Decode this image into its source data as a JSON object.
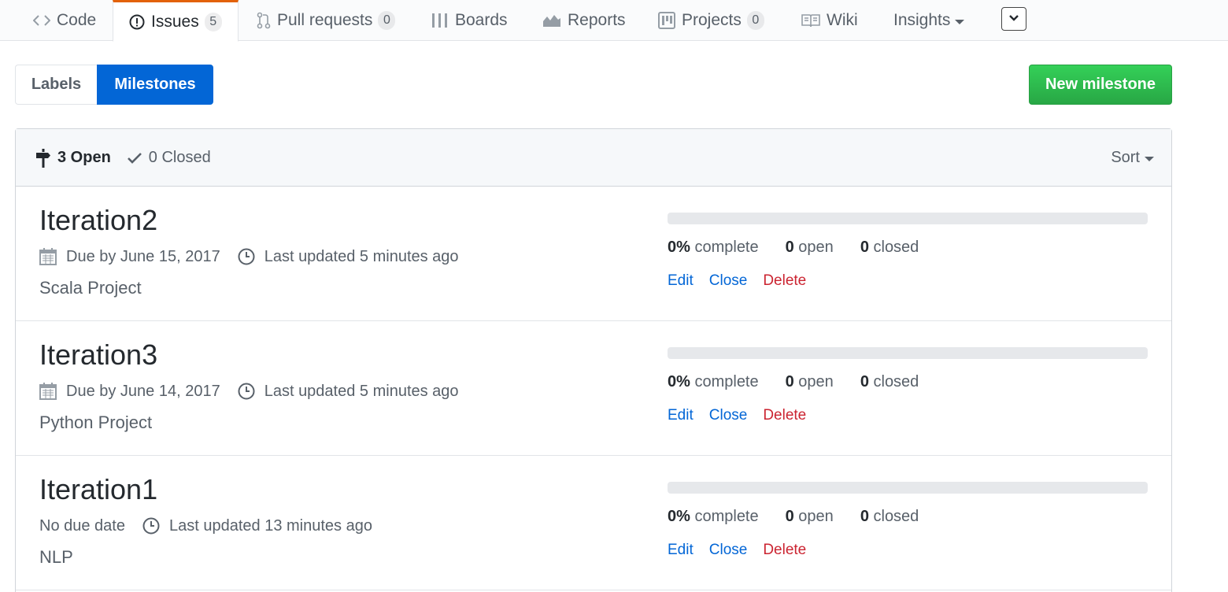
{
  "nav": {
    "code": "Code",
    "issues": "Issues",
    "issues_count": "5",
    "pulls": "Pull requests",
    "pulls_count": "0",
    "boards": "Boards",
    "reports": "Reports",
    "projects": "Projects",
    "projects_count": "0",
    "wiki": "Wiki",
    "insights": "Insights"
  },
  "subnav": {
    "labels": "Labels",
    "milestones": "Milestones"
  },
  "new_milestone_label": "New milestone",
  "header": {
    "open_label": "3 Open",
    "closed_label": "0 Closed",
    "sort_label": "Sort"
  },
  "colors": {
    "accent": "#0366d6",
    "primary_button": "#28a745",
    "danger": "#cb2431",
    "selected_tab_border": "#e36209"
  },
  "milestones": [
    {
      "title": "Iteration2",
      "due": "Due by June 15, 2017",
      "updated": "Last updated 5 minutes ago",
      "description": "Scala Project",
      "progress_fraction": 0,
      "percent": "0%",
      "percent_suffix": " complete",
      "open_count": "0",
      "open_label": " open",
      "closed_count": "0",
      "closed_label": " closed",
      "edit": "Edit",
      "close": "Close",
      "delete": "Delete"
    },
    {
      "title": "Iteration3",
      "due": "Due by June 14, 2017",
      "updated": "Last updated 5 minutes ago",
      "description": "Python Project",
      "progress_fraction": 0,
      "percent": "0%",
      "percent_suffix": " complete",
      "open_count": "0",
      "open_label": " open",
      "closed_count": "0",
      "closed_label": " closed",
      "edit": "Edit",
      "close": "Close",
      "delete": "Delete"
    },
    {
      "title": "Iteration1",
      "due": "No due date",
      "updated": "Last updated 13 minutes ago",
      "description": "NLP",
      "progress_fraction": 0,
      "percent": "0%",
      "percent_suffix": " complete",
      "open_count": "0",
      "open_label": " open",
      "closed_count": "0",
      "closed_label": " closed",
      "edit": "Edit",
      "close": "Close",
      "delete": "Delete"
    }
  ]
}
